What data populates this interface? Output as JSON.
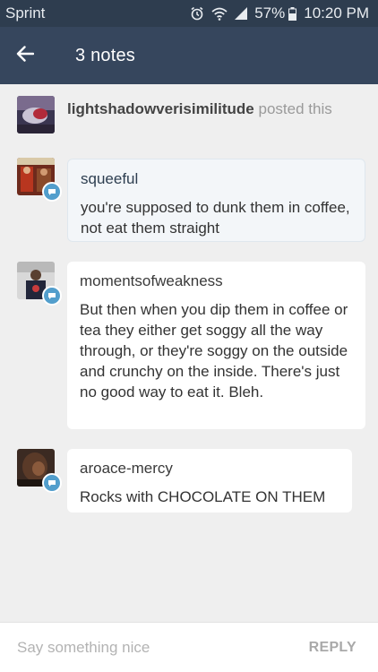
{
  "status_bar": {
    "carrier": "Sprint",
    "battery": "57%",
    "time": "10:20 PM",
    "icons": [
      "alarm-icon",
      "wifi-icon",
      "signal-icon",
      "battery-icon"
    ]
  },
  "header": {
    "back_icon": "arrow-left-icon",
    "title": "3 notes"
  },
  "poster": {
    "username": "lightshadowverisimilitude",
    "action": "posted this"
  },
  "notes": [
    {
      "username": "squeeful",
      "text": "you're supposed to dunk them in coffee, not eat them straight",
      "highlighted": true
    },
    {
      "username": "momentsofweakness",
      "text": "But then when you dip them in coffee or tea they either get soggy all the way through, or they're soggy on the outside and crunchy on the inside. There's just no good way to eat it. Bleh.",
      "highlighted": false
    },
    {
      "username": "aroace-mercy",
      "text": "Rocks with CHOCOLATE ON THEM",
      "highlighted": false
    }
  ],
  "compose": {
    "placeholder": "Say something nice",
    "reply_label": "REPLY"
  },
  "colors": {
    "status_bar": "#2e3d4f",
    "app_bar": "#36465d",
    "background": "#efefef",
    "badge": "#529ecc"
  }
}
